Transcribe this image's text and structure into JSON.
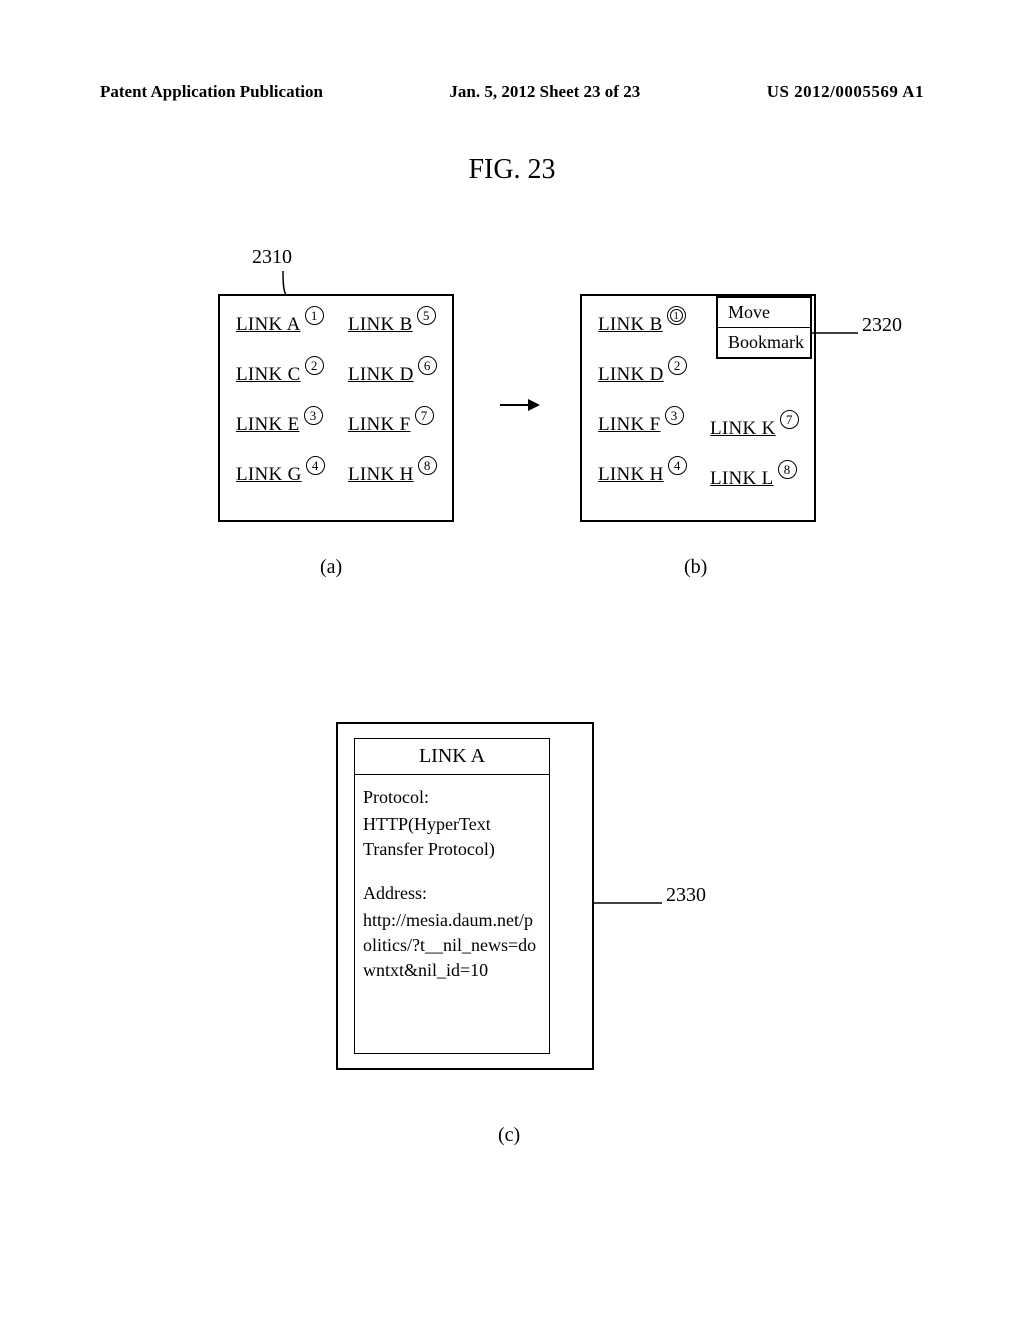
{
  "header": {
    "left": "Patent Application Publication",
    "center": "Jan. 5, 2012   Sheet 23 of 23",
    "right": "US 2012/0005569 A1"
  },
  "figure_title": "FIG. 23",
  "ref": {
    "r2310": "2310",
    "r2320": "2320",
    "r2330": "2330"
  },
  "captions": {
    "a": "(a)",
    "b": "(b)",
    "c": "(c)"
  },
  "panelA": {
    "col1": [
      {
        "label": "LINK A",
        "num": "1"
      },
      {
        "label": "LINK C",
        "num": "2"
      },
      {
        "label": "LINK E",
        "num": "3"
      },
      {
        "label": "LINK G",
        "num": "4"
      }
    ],
    "col2": [
      {
        "label": "LINK B",
        "num": "5"
      },
      {
        "label": "LINK D",
        "num": "6"
      },
      {
        "label": "LINK F",
        "num": "7"
      },
      {
        "label": "LINK H",
        "num": "8"
      }
    ]
  },
  "panelB": {
    "col1": [
      {
        "label": "LINK B",
        "num": "1",
        "dbl": true
      },
      {
        "label": "LINK D",
        "num": "2"
      },
      {
        "label": "LINK F",
        "num": "3"
      },
      {
        "label": "LINK H",
        "num": "4"
      }
    ],
    "col2": [
      {
        "label": "LINK K",
        "num": "7"
      },
      {
        "label": "LINK L",
        "num": "8"
      }
    ],
    "menu": {
      "item1": "Move",
      "item2": "Bookmark"
    }
  },
  "panelC": {
    "title": "LINK A",
    "protocol_label": "Protocol:",
    "protocol_value": "HTTP(HyperText Transfer Protocol)",
    "address_label": "Address:",
    "address_value": "http://mesia.daum.net/politics/?t__nil_news=downtxt&nil_id=10"
  }
}
